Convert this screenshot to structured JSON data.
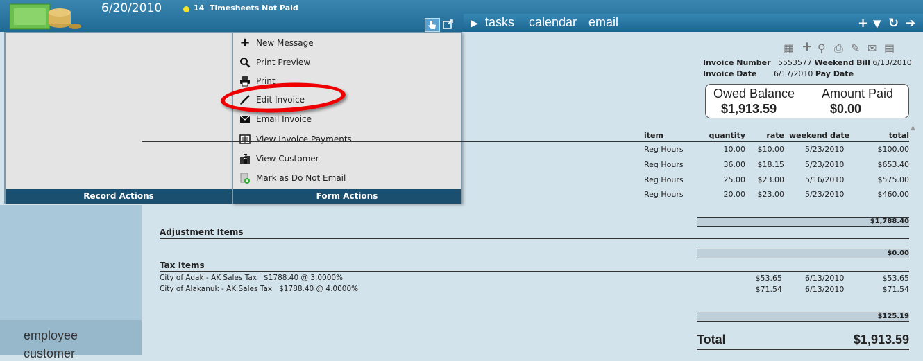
{
  "header": {
    "date": "6/20/2010",
    "notice_count": "14",
    "notice_text": "Timesheets Not Paid",
    "nav": [
      "tasks",
      "calendar",
      "email"
    ]
  },
  "record_panel": {
    "footer": "Record Actions"
  },
  "form_panel": {
    "footer": "Form Actions",
    "items": [
      {
        "label": "New Message",
        "icon": "plus-icon"
      },
      {
        "label": "Print Preview",
        "icon": "magnifier-icon"
      },
      {
        "label": "Print",
        "icon": "printer-icon"
      },
      {
        "label": "Edit Invoice",
        "icon": "pencil-icon"
      },
      {
        "label": "Email Invoice",
        "icon": "envelope-icon"
      },
      {
        "label": "View Invoice Payments",
        "icon": "payments-icon"
      },
      {
        "label": "View Customer",
        "icon": "building-icon"
      },
      {
        "label": "Mark as Do Not Email",
        "icon": "mark-icon"
      }
    ]
  },
  "left_nav": {
    "items": [
      "employee",
      "customer"
    ]
  },
  "invoice": {
    "number_label": "Invoice Number",
    "number": "5553577",
    "weekend_bill_label": "Weekend Bill",
    "weekend_bill": "6/13/2010",
    "date_label": "Invoice Date",
    "date": "6/17/2010",
    "pay_date_label": "Pay Date",
    "owed_label": "Owed Balance",
    "owed": "$1,913.59",
    "paid_label": "Amount Paid",
    "paid": "$0.00"
  },
  "items_table": {
    "headers": [
      "item",
      "quantity",
      "rate",
      "weekend date",
      "total"
    ],
    "rows": [
      [
        "Reg Hours",
        "10.00",
        "$10.00",
        "5/23/2010",
        "$100.00"
      ],
      [
        "Reg Hours",
        "36.00",
        "$18.15",
        "5/23/2010",
        "$653.40"
      ],
      [
        "Reg Hours",
        "25.00",
        "$23.00",
        "5/16/2010",
        "$575.00"
      ],
      [
        "Reg Hours",
        "20.00",
        "$23.00",
        "5/23/2010",
        "$460.00"
      ]
    ],
    "subtotal": "$1,788.40"
  },
  "adjustments": {
    "title": "Adjustment Items",
    "subtotal": "$0.00"
  },
  "tax": {
    "title": "Tax Items",
    "rows": [
      {
        "desc": "City of Adak - AK Sales Tax   $1788.40 @ 3.0000%",
        "amount": "$53.65",
        "date": "6/13/2010",
        "total": "$53.65"
      },
      {
        "desc": "City of Alakanuk - AK Sales Tax   $1788.40 @ 4.0000%",
        "amount": "$71.54",
        "date": "6/13/2010",
        "total": "$71.54"
      }
    ],
    "subtotal": "$125.19"
  },
  "total": {
    "label": "Total",
    "value": "$1,913.59"
  }
}
